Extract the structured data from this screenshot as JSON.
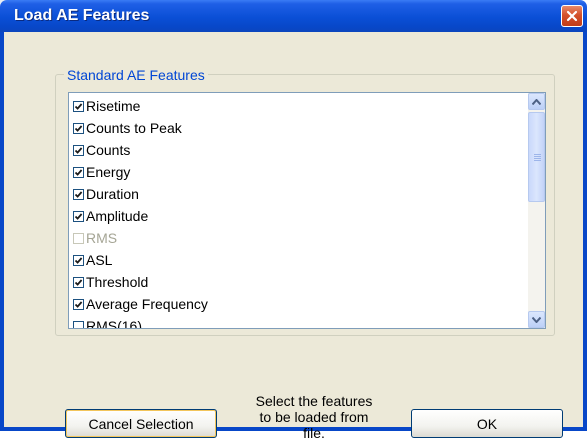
{
  "window": {
    "title": "Load AE Features"
  },
  "group": {
    "label": "Standard AE Features"
  },
  "features": [
    {
      "label": "Risetime",
      "checked": true,
      "enabled": true
    },
    {
      "label": "Counts to Peak",
      "checked": true,
      "enabled": true
    },
    {
      "label": "Counts",
      "checked": true,
      "enabled": true
    },
    {
      "label": "Energy",
      "checked": true,
      "enabled": true
    },
    {
      "label": "Duration",
      "checked": true,
      "enabled": true
    },
    {
      "label": "Amplitude",
      "checked": true,
      "enabled": true
    },
    {
      "label": "RMS",
      "checked": false,
      "enabled": false
    },
    {
      "label": "ASL",
      "checked": true,
      "enabled": true
    },
    {
      "label": "Threshold",
      "checked": true,
      "enabled": true
    },
    {
      "label": "Average Frequency",
      "checked": true,
      "enabled": true
    },
    {
      "label": "RMS(16)",
      "checked": false,
      "enabled": true
    }
  ],
  "buttons": {
    "cancel_label": "Cancel Selection",
    "ok_label": "OK"
  },
  "hint": {
    "line1": "Select the features",
    "line2": "to be loaded from",
    "line3": "file."
  },
  "colors": {
    "titlebar": "#0a4fd6",
    "group_label": "#0046d5",
    "dialog_bg": "#ece9d8",
    "close_button": "#d4512b"
  },
  "icons": {
    "close": "close-x-icon",
    "scroll_up": "arrow-up-icon",
    "scroll_down": "arrow-down-icon"
  }
}
